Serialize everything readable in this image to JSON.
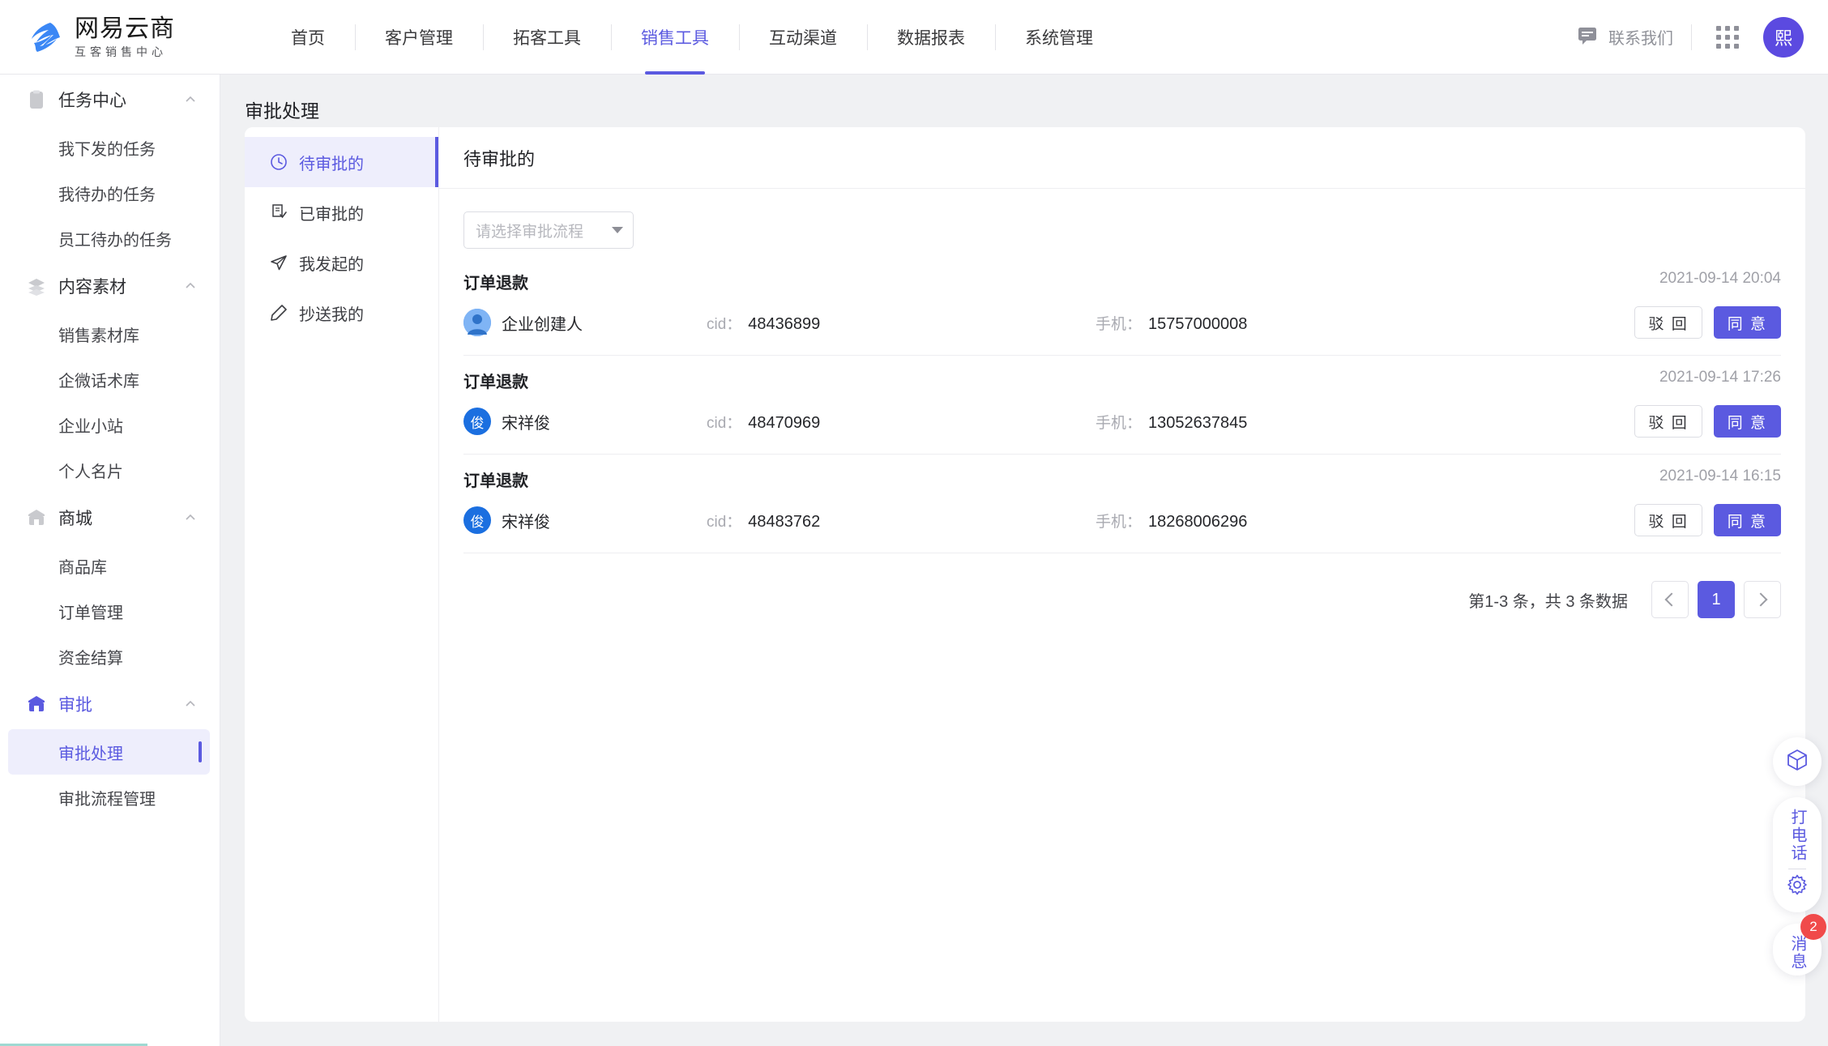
{
  "brand": {
    "title": "网易云商",
    "subtitle": "互客销售中心",
    "accent": "#5b5ae0"
  },
  "topnav": {
    "items": [
      {
        "label": "首页",
        "active": false
      },
      {
        "label": "客户管理",
        "active": false
      },
      {
        "label": "拓客工具",
        "active": false
      },
      {
        "label": "销售工具",
        "active": true
      },
      {
        "label": "互动渠道",
        "active": false
      },
      {
        "label": "数据报表",
        "active": false
      },
      {
        "label": "系统管理",
        "active": false
      }
    ],
    "contact_label": "联系我们",
    "avatar_initial": "熙"
  },
  "sidebar": {
    "groups": [
      {
        "label": "任务中心",
        "icon": "clipboard-icon",
        "active": false,
        "items": [
          {
            "label": "我下发的任务",
            "active": false
          },
          {
            "label": "我待办的任务",
            "active": false
          },
          {
            "label": "员工待办的任务",
            "active": false
          }
        ]
      },
      {
        "label": "内容素材",
        "icon": "layers-icon",
        "active": false,
        "items": [
          {
            "label": "销售素材库",
            "active": false
          },
          {
            "label": "企微话术库",
            "active": false
          },
          {
            "label": "企业小站",
            "active": false
          },
          {
            "label": "个人名片",
            "active": false
          }
        ]
      },
      {
        "label": "商城",
        "icon": "shop-icon",
        "active": false,
        "items": [
          {
            "label": "商品库",
            "active": false
          },
          {
            "label": "订单管理",
            "active": false
          },
          {
            "label": "资金结算",
            "active": false
          }
        ]
      },
      {
        "label": "审批",
        "icon": "shop-icon",
        "active": true,
        "items": [
          {
            "label": "审批处理",
            "active": true
          },
          {
            "label": "审批流程管理",
            "active": false
          }
        ]
      }
    ]
  },
  "page": {
    "title": "审批处理",
    "subnav": [
      {
        "label": "待审批的",
        "icon": "clock-icon",
        "active": true
      },
      {
        "label": "已审批的",
        "icon": "doc-check-icon",
        "active": false
      },
      {
        "label": "我发起的",
        "icon": "send-icon",
        "active": false
      },
      {
        "label": "抄送我的",
        "icon": "pencil-icon",
        "active": false
      }
    ],
    "content_title": "待审批的",
    "filter": {
      "placeholder": "请选择审批流程",
      "value": ""
    },
    "labels": {
      "cid": "cid：",
      "phone": "手机：",
      "reject": "驳 回",
      "approve": "同 意"
    },
    "rows": [
      {
        "title": "订单退款",
        "avatar_type": "image",
        "avatar_initial": "",
        "name": "企业创建人",
        "cid": "48436899",
        "phone": "15757000008",
        "time": "2021-09-14 20:04"
      },
      {
        "title": "订单退款",
        "avatar_type": "letter",
        "avatar_initial": "俊",
        "name": "宋祥俊",
        "cid": "48470969",
        "phone": "13052637845",
        "time": "2021-09-14 17:26"
      },
      {
        "title": "订单退款",
        "avatar_type": "letter",
        "avatar_initial": "俊",
        "name": "宋祥俊",
        "cid": "48483762",
        "phone": "18268006296",
        "time": "2021-09-14 16:15"
      }
    ],
    "pagination": {
      "summary": "第1-3 条，共 3 条数据",
      "current_page": "1"
    }
  },
  "dock": {
    "cube_icon": "cube-icon",
    "call_label": "打电话",
    "gear_icon": "gear-icon",
    "message_label": "消息",
    "message_badge": "2"
  }
}
